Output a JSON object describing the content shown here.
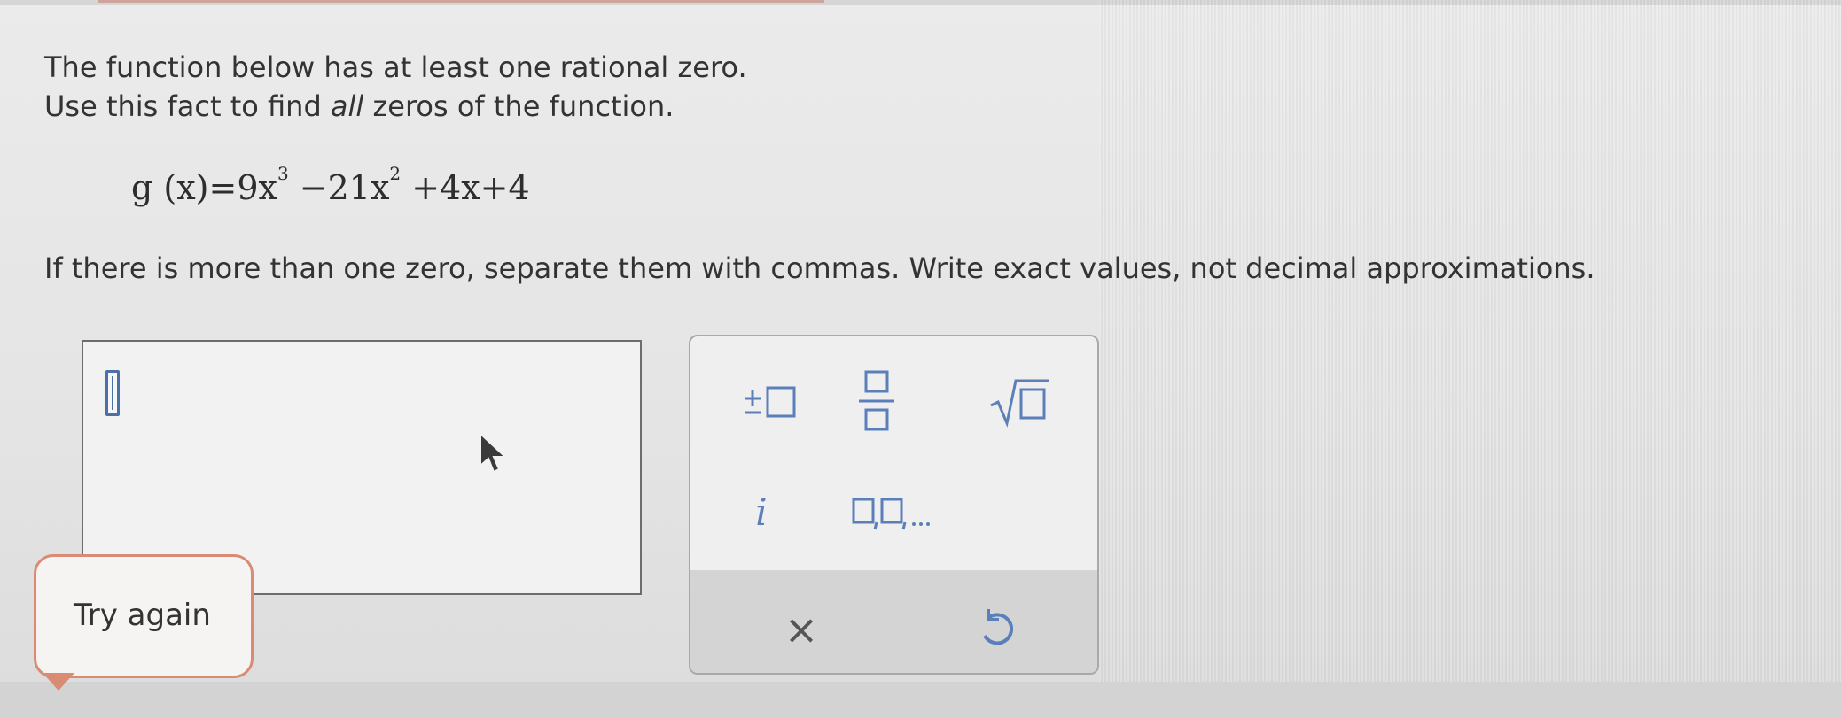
{
  "question": {
    "line1": "The function below has at least one rational zero.",
    "line2_pre": "Use this fact to find ",
    "line2_em": "all",
    "line2_post": " zeros of the function.",
    "instruction": "If there is more than one zero, separate them with commas. Write exact values, not decimal approximations."
  },
  "formula": {
    "lhs": "g (x)",
    "eq": "=",
    "t1_coef": "9x",
    "t1_exp": "3",
    "t2": " −21x",
    "t2_exp": "2",
    "t3": " +4x+4"
  },
  "feedback": {
    "label": "Try again"
  },
  "keypad": {
    "keys": [
      "plus-minus",
      "fraction",
      "square-root",
      "imaginary-unit",
      "list"
    ],
    "i_label": "i",
    "clear_label": "×",
    "accent_color": "#5b7fb8"
  }
}
